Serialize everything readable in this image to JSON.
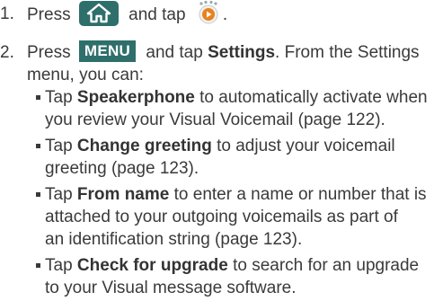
{
  "steps": [
    {
      "number": "1.",
      "parts": [
        "Press",
        "and tap",
        "."
      ],
      "icons": [
        "home-key-icon",
        "voicemail-app-icon"
      ]
    },
    {
      "number": "2.",
      "parts": [
        "Press",
        "and tap",
        ". From the Settings"
      ],
      "key_label": "MENU",
      "bold": "Settings",
      "line2": "menu, you can:"
    }
  ],
  "bullets": [
    {
      "prefix": "Tap",
      "bold": "Speakerphone",
      "rest1": "to automatically activate when",
      "line2": "you review your Visual Voicemail (page 122)."
    },
    {
      "prefix": "Tap",
      "bold": "Change greeting",
      "rest1": "to adjust your voicemail",
      "line2": "greeting (page 123)."
    },
    {
      "prefix": "Tap",
      "bold": "From name",
      "rest1": "to enter a name or number that is",
      "line2": "attached to your outgoing voicemails as part of",
      "line3": "an identification string (page 123)."
    },
    {
      "prefix": "Tap",
      "bold": "Check for upgrade",
      "rest1": "to search for an upgrade",
      "line2": "to your Visual message software."
    }
  ],
  "colors": {
    "key_background": "#2e6f6b",
    "text": "#3a3a3a",
    "vm_icon_orange": "#e8821e"
  }
}
